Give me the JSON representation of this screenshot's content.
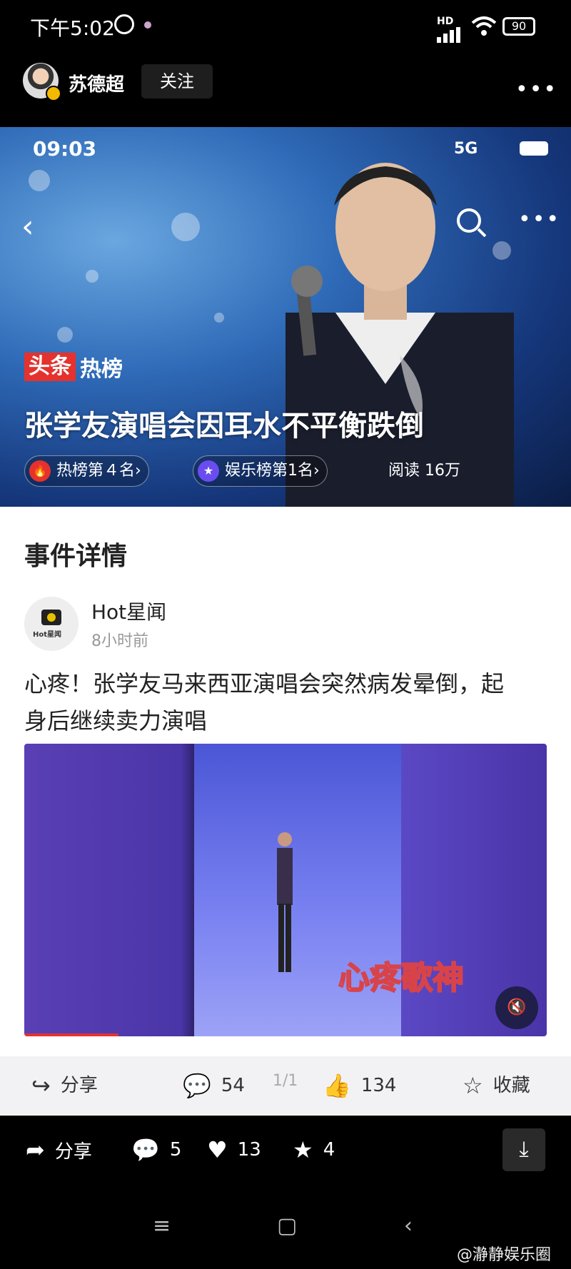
{
  "status_bar": {
    "time": "下午5:02",
    "hd": "HD",
    "battery": "90"
  },
  "author": {
    "name": "苏德超",
    "follow_label": "关注"
  },
  "hero": {
    "inner_time": "09:03",
    "inner_network": "5G",
    "badge_red": "头条",
    "badge_white": "热榜",
    "headline": "张学友演唱会因耳水不平衡跌倒",
    "pills": [
      {
        "label": "热榜第４名›",
        "icon": "fire-icon",
        "color": "#e5322d"
      },
      {
        "label": "娱乐榜第1名›",
        "icon": "star-icon",
        "color": "#6a4cf0"
      }
    ],
    "reads": "阅读 16万"
  },
  "card": {
    "section_title": "事件详情",
    "source_name": "Hot星闻",
    "source_logo_text": "Hot星闻",
    "source_time": "8小时前",
    "body": "心疼！张学友马来西亚演唱会突然病发晕倒，起身后继续卖力演唱",
    "video_caption": "心疼歌神",
    "video_progress": 0.18,
    "actions": {
      "share": "分享",
      "comments": "54",
      "page": "1/1",
      "likes": "134",
      "favorite": "收藏"
    }
  },
  "bottom_bar": {
    "share": "分享",
    "comments": "5",
    "likes": "13",
    "stars": "4"
  },
  "watermark": "@瀞静娱乐圈"
}
